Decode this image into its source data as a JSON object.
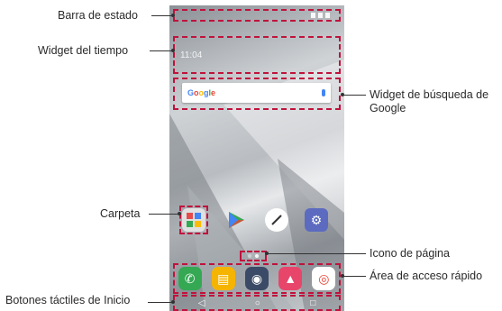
{
  "callouts": {
    "status_bar": "Barra de estado",
    "weather_widget": "Widget del tiempo",
    "google_search_widget_line1": "Widget de búsqueda de",
    "google_search_widget_line2": "Google",
    "folder": "Carpeta",
    "page_icon": "Icono de página",
    "quick_access": "Área de acceso rápido",
    "home_touch_buttons": "Botones táctiles de Inicio"
  },
  "phone": {
    "weather_text": "11:04",
    "search_logo": "Google",
    "apps": [
      {
        "name": "folder-app",
        "icon": "grid-icon",
        "label": "",
        "color": "#e0e0e0"
      },
      {
        "name": "play-store-app",
        "icon": "play-store-icon",
        "label": "",
        "color": "#ffffff"
      },
      {
        "name": "notes-app",
        "icon": "pen-icon",
        "label": "",
        "color": "#ffffff"
      },
      {
        "name": "settings-app",
        "icon": "gear-icon",
        "label": "",
        "color": "#5c6bc0"
      }
    ],
    "dock": [
      {
        "name": "phone-app",
        "icon": "phone-icon",
        "color": "#34a853",
        "glyph": "✆"
      },
      {
        "name": "messages-app",
        "icon": "message-icon",
        "color": "#f5b400",
        "glyph": "▤"
      },
      {
        "name": "camera-app",
        "icon": "camera-icon",
        "color": "#3b4a66",
        "glyph": "◉"
      },
      {
        "name": "gallery-app",
        "icon": "gallery-icon",
        "color": "#e8456b",
        "glyph": "▲"
      },
      {
        "name": "chrome-app",
        "icon": "chrome-icon",
        "color": "#ffffff",
        "glyph": "◎"
      }
    ],
    "nav": {
      "back": "◁",
      "home": "○",
      "recents": "□"
    }
  },
  "colors": {
    "frame": "#c0123c",
    "leader": "#333333"
  }
}
